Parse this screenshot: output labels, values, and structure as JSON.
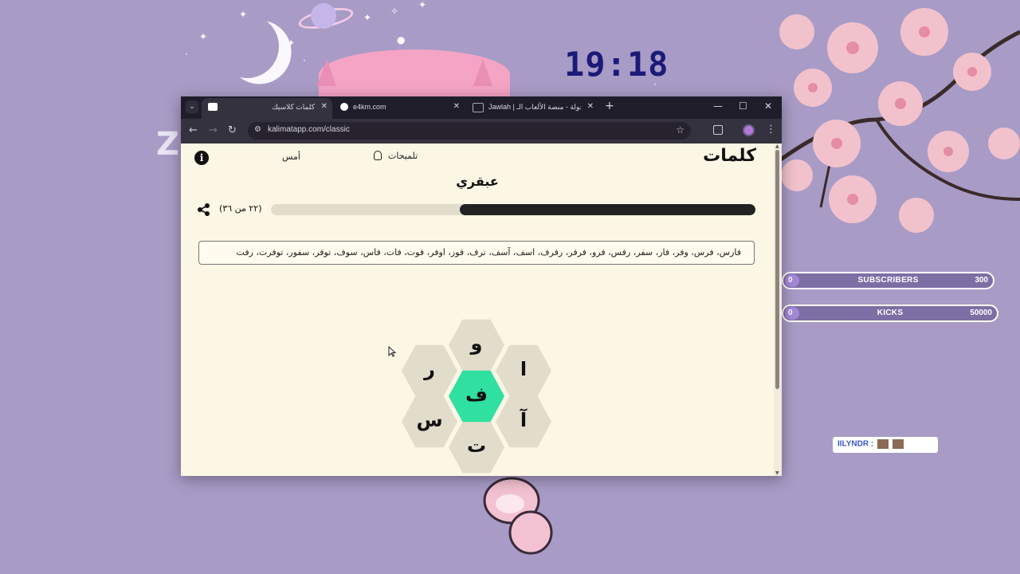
{
  "desktop": {
    "clock": "19:18",
    "stream_goals": [
      {
        "label": "SUBSCRIBERS",
        "current": "0",
        "target": "300"
      },
      {
        "label": "KICKS",
        "current": "0",
        "target": "50000"
      }
    ],
    "streamer_tag": "IILYNDR :"
  },
  "browser": {
    "tabs": [
      {
        "title": "كلمات كلاسيك",
        "active": true
      },
      {
        "title": "e4km.com",
        "active": false
      },
      {
        "title": "Jawlah | جولة - منصة الألعاب الـ",
        "active": false
      }
    ],
    "url": "kalimatapp.com/classic"
  },
  "app": {
    "logo": "كلمات",
    "hints_label": "تلميحات",
    "yesterday_label": "أمس",
    "rank": "عبقري",
    "score_text": "(٢٢ من ٣٦)",
    "progress": 0.61,
    "found_words": "فارس، فرس، وفر، فار، سفر، رفس، فرو، فرفر، رفرف، اسف، آسف، ترف، فور، اوفر، فوت، فات، فاس، سوف، توفر، سفور، توفرت، رفت",
    "letters": {
      "top": "و",
      "upper_right": "ا",
      "lower_right": "آ",
      "bottom": "ت",
      "lower_left": "س",
      "upper_left": "ر",
      "center": "ف"
    }
  },
  "colors": {
    "desktop_bg": "#a89bc6",
    "page_bg": "#fcf6e4",
    "center_hex": "#2fe0a0",
    "hex": "#e2dccb",
    "progress_fill": "#222222",
    "clock": "#1c1a78"
  }
}
